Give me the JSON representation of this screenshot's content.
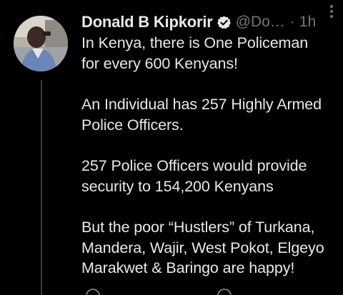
{
  "tweet": {
    "author": {
      "name": "Donald B Kipkorir",
      "handle": "@Do…",
      "separator": "·",
      "time": "1h",
      "avatar_icon": "profile-photo",
      "verified_icon": "verified-badge-icon"
    },
    "paragraphs": [
      [
        "In Kenya, there is One Policeman",
        "for every 600 Kenyans!"
      ],
      [
        "An Individual has 257 Highly Armed",
        "Police Officers."
      ],
      [
        "257 Police Officers would provide",
        "security to 154,200 Kenyans"
      ],
      [
        "But the poor “Hustlers” of Turkana,",
        "Mandera, Wajir, West Pokot, Elgeyo",
        "Marakwet & Baringo are happy!"
      ]
    ],
    "more_icon": "more-vertical-icon"
  },
  "colors": {
    "background": "#000000",
    "text_primary": "#e7e9ea",
    "text_secondary": "#71767b",
    "verified_accent": "#e7e9ea",
    "thread_line": "#3a3d41"
  }
}
